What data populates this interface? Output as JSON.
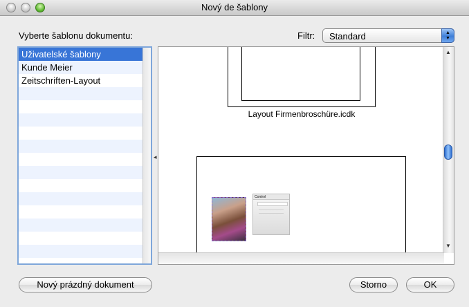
{
  "window": {
    "title": "Nový de šablony"
  },
  "prompt": {
    "label": "Vyberte šablonu dokumentu:"
  },
  "filter": {
    "label": "Filtr:",
    "selected": "Standard"
  },
  "templates": {
    "items": [
      {
        "label": "Uživatelské šablony",
        "selected": true
      },
      {
        "label": "Kunde Meier",
        "selected": false
      },
      {
        "label": "Zeitschriften-Layout",
        "selected": false
      }
    ]
  },
  "preview": {
    "caption": "Layout Firmenbroschüre.icdk",
    "thumbnail": {
      "title": "Control"
    }
  },
  "buttons": {
    "new_blank": "Nový prázdný dokument",
    "cancel": "Storno",
    "ok": "OK"
  },
  "colors": {
    "selection": "#3875d7",
    "accent": "#3f7fd8"
  }
}
